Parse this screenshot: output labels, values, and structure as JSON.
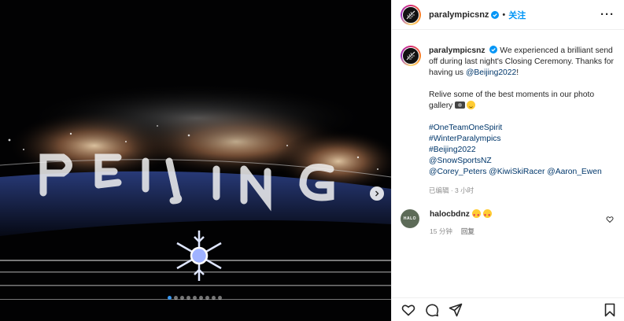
{
  "post": {
    "media": {
      "photo_description_icon": "fireworks-photo",
      "slides_total": 9,
      "active_slide": 1,
      "next_icon": "chevron-right-icon"
    },
    "header": {
      "username": "paralympicsnz",
      "separator": "•",
      "follow_label": "关注",
      "more_icon": "more-options-icon",
      "verified_icon": "verified-badge-icon"
    },
    "caption": {
      "username": "paralympicsnz",
      "line1": "We experienced a brilliant send off during last night's Closing Ceremony. Thanks for having us ",
      "mention_beijing": "@Beijing2022",
      "line1_end": "!",
      "line2": "Relive some of the best moments in our photo gallery ",
      "hashtags": [
        "#OneTeamOneSpirit",
        "#WinterParalympics",
        "#Beijing2022"
      ],
      "mention_snowsports": "@SnowSportsNZ",
      "mentions_last": [
        "@Corey_Peters",
        "@KiwiSkiRacer",
        "@Aaron_Ewen"
      ],
      "meta": "已编辑 · 3 小时"
    },
    "comments": [
      {
        "avatar_text": "HALO",
        "username": "halocbdnz",
        "time": "15 分钟",
        "reply_label": "回复",
        "heart_icon": "like-heart-icon"
      }
    ],
    "actions": {
      "like_icon": "heart-icon",
      "comment_icon": "comment-icon",
      "share_icon": "share-icon",
      "save_icon": "bookmark-icon"
    },
    "colors": {
      "accent": "#0095f6",
      "link": "#00376b",
      "muted": "#8e8e8e",
      "carousel_active": "#3897f0"
    }
  }
}
